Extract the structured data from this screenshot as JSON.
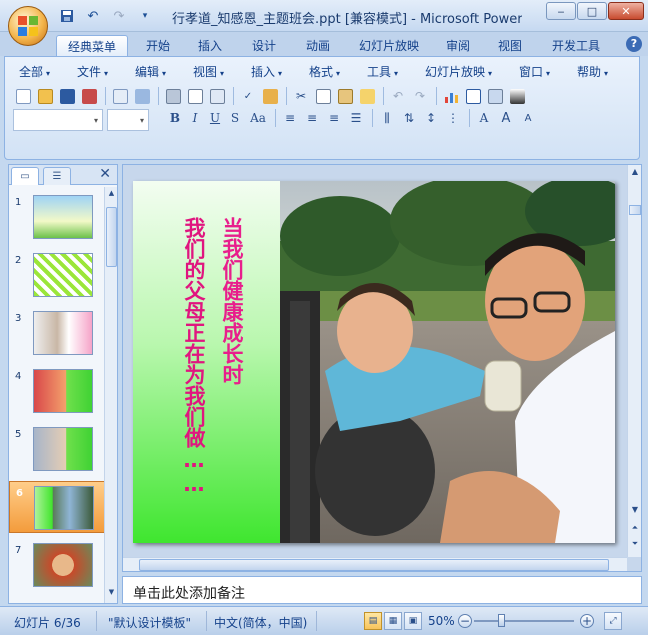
{
  "window": {
    "title": "行孝道_知感恩_主题班会.ppt [兼容模式] - Microsoft PowerPoi...",
    "minimize": "‒",
    "maximize": "□",
    "close": "✕"
  },
  "ribbon_tabs": [
    "经典菜单",
    "开始",
    "插入",
    "设计",
    "动画",
    "幻灯片放映",
    "审阅",
    "视图",
    "开发工具"
  ],
  "menus": [
    "全部",
    "文件",
    "编辑",
    "视图",
    "插入",
    "格式",
    "工具",
    "幻灯片放映",
    "窗口",
    "帮助"
  ],
  "toolbar": {
    "font_name_value": "",
    "font_size_value": "",
    "bold": "B",
    "italic": "I",
    "underline": "U",
    "strike": "S",
    "case": "Aa"
  },
  "left_panel": {
    "slide_numbers": [
      "1",
      "2",
      "3",
      "4",
      "5",
      "6",
      "7"
    ],
    "selected": "6"
  },
  "slide": {
    "line1": "当我们健康成长时",
    "line2": "我们的父母正在为我们做……"
  },
  "notes": {
    "placeholder": "单击此处添加备注"
  },
  "status": {
    "slide_counter": "幻灯片 6/36",
    "theme": "\"默认设计模板\"",
    "language": "中文(简体，中国)",
    "zoom": "50%"
  },
  "colors": {
    "accent": "#15428b",
    "slide_text": "#e81e8c",
    "slide_green": "#3fe62f",
    "selected_thumb": "#f39c3c"
  }
}
